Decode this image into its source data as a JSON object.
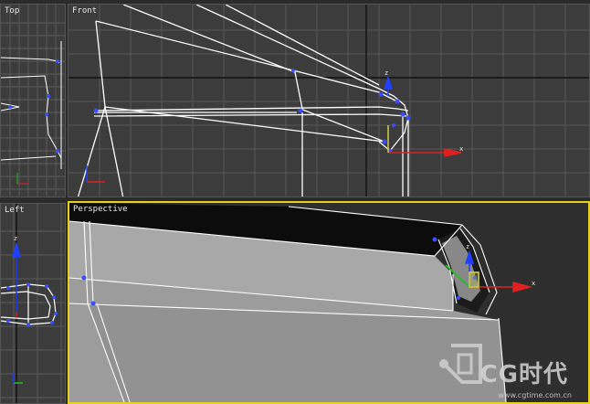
{
  "viewports": {
    "top": {
      "label": "Top"
    },
    "front": {
      "label": "Front"
    },
    "left": {
      "label": "Left"
    },
    "perspective": {
      "label": "Perspective"
    }
  },
  "gizmo": {
    "x_axis": "x",
    "z_axis": "z",
    "y_axis": "y"
  },
  "watermark": {
    "brand": "CG时代",
    "url": "www.cgtime.com.cn"
  },
  "colors": {
    "active_border": "#e6d21e",
    "grid": "#555555",
    "wire": "#ffffff",
    "vertex": "#3a4dff",
    "x_axis": "#e02020",
    "y_axis": "#20c020",
    "z_axis": "#2040ff"
  }
}
